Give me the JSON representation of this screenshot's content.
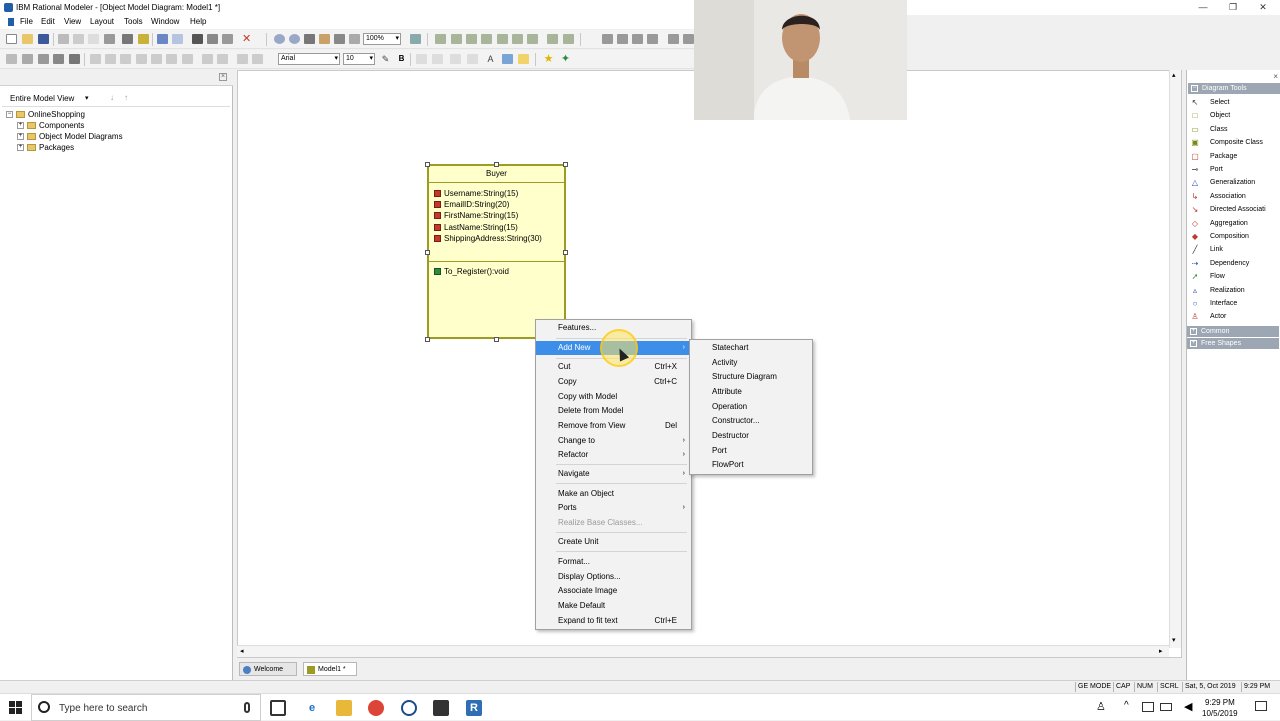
{
  "window": {
    "title": "IBM Rational Modeler - [Object Model Diagram: Model1 *]",
    "minimize": "—",
    "restore": "❐",
    "close": "✕"
  },
  "menubar": [
    "File",
    "Edit",
    "View",
    "Layout",
    "Tools",
    "Window",
    "Help"
  ],
  "toolbar": {
    "zoom": "100%",
    "font": "Arial",
    "font_size": "10",
    "bold": "B"
  },
  "model_view": {
    "title": "Entire Model View",
    "tree": [
      {
        "label": "OnlineShopping",
        "level": 0
      },
      {
        "label": "Components",
        "level": 1
      },
      {
        "label": "Object Model Diagrams",
        "level": 1
      },
      {
        "label": "Packages",
        "level": 1
      }
    ]
  },
  "class_box": {
    "name": "Buyer",
    "attributes": [
      "Username:String(15)",
      "EmailID:String(20)",
      "FirstName:String(15)",
      "LastName:String(15)",
      "ShippingAddress:String(30)"
    ],
    "operations": [
      "To_Register():void"
    ]
  },
  "context_menu": {
    "items": [
      {
        "label": "Features...",
        "shortcut": "",
        "submenu": false,
        "disabled": false
      },
      {
        "label": "Add New",
        "shortcut": "",
        "submenu": true,
        "disabled": false,
        "highlighted": true
      },
      {
        "label": "Cut",
        "shortcut": "Ctrl+X",
        "submenu": false,
        "disabled": false
      },
      {
        "label": "Copy",
        "shortcut": "Ctrl+C",
        "submenu": false,
        "disabled": false
      },
      {
        "label": "Copy with Model",
        "shortcut": "",
        "submenu": false,
        "disabled": false
      },
      {
        "label": "Delete from Model",
        "shortcut": "",
        "submenu": false,
        "disabled": false
      },
      {
        "label": "Remove from View",
        "shortcut": "Del",
        "submenu": false,
        "disabled": false
      },
      {
        "label": "Change to",
        "shortcut": "",
        "submenu": true,
        "disabled": false
      },
      {
        "label": "Refactor",
        "shortcut": "",
        "submenu": true,
        "disabled": false
      },
      {
        "label": "Navigate",
        "shortcut": "",
        "submenu": true,
        "disabled": false
      },
      {
        "label": "Make an Object",
        "shortcut": "",
        "submenu": false,
        "disabled": false
      },
      {
        "label": "Ports",
        "shortcut": "",
        "submenu": true,
        "disabled": false
      },
      {
        "label": "Realize Base Classes...",
        "shortcut": "",
        "submenu": false,
        "disabled": true
      },
      {
        "label": "Create Unit",
        "shortcut": "",
        "submenu": false,
        "disabled": false
      },
      {
        "label": "Format...",
        "shortcut": "",
        "submenu": false,
        "disabled": false
      },
      {
        "label": "Display Options...",
        "shortcut": "",
        "submenu": false,
        "disabled": false
      },
      {
        "label": "Associate Image",
        "shortcut": "",
        "submenu": false,
        "disabled": false
      },
      {
        "label": "Make Default",
        "shortcut": "",
        "submenu": false,
        "disabled": false
      },
      {
        "label": "Expand to fit text",
        "shortcut": "Ctrl+E",
        "submenu": false,
        "disabled": false
      }
    ]
  },
  "submenu": {
    "items": [
      "Statechart",
      "Activity",
      "Structure Diagram",
      "Attribute",
      "Operation",
      "Constructor...",
      "Destructor",
      "Port",
      "FlowPort"
    ]
  },
  "diagram_tools": {
    "header": "Diagram Tools",
    "tools": [
      {
        "label": "Select",
        "icon": "arrow-icon",
        "color": "#333333"
      },
      {
        "label": "Object",
        "icon": "object-icon",
        "color": "#7a8a10"
      },
      {
        "label": "Class",
        "icon": "class-icon",
        "color": "#7a8a10"
      },
      {
        "label": "Composite Class",
        "icon": "composite-class-icon",
        "color": "#7a8a10"
      },
      {
        "label": "Package",
        "icon": "package-icon",
        "color": "#c0392b"
      },
      {
        "label": "Port",
        "icon": "port-icon",
        "color": "#333333"
      },
      {
        "label": "Generalization",
        "icon": "generalization-icon",
        "color": "#1f4fa8"
      },
      {
        "label": "Association",
        "icon": "association-icon",
        "color": "#c0392b"
      },
      {
        "label": "Directed Associati",
        "icon": "directed-association-icon",
        "color": "#c0392b"
      },
      {
        "label": "Aggregation",
        "icon": "aggregation-icon",
        "color": "#c0392b"
      },
      {
        "label": "Composition",
        "icon": "composition-icon",
        "color": "#c0392b"
      },
      {
        "label": "Link",
        "icon": "link-icon",
        "color": "#333333"
      },
      {
        "label": "Dependency",
        "icon": "dependency-icon",
        "color": "#1f4fa8"
      },
      {
        "label": "Flow",
        "icon": "flow-icon",
        "color": "#2e8b3e"
      },
      {
        "label": "Realization",
        "icon": "realization-icon",
        "color": "#1f4fa8"
      },
      {
        "label": "Interface",
        "icon": "interface-icon",
        "color": "#1f4fa8"
      },
      {
        "label": "Actor",
        "icon": "actor-icon",
        "color": "#c0392b"
      }
    ],
    "sections": [
      "Common",
      "Free Shapes"
    ]
  },
  "doc_tabs": [
    "Welcome to...",
    "Model1 *"
  ],
  "statusbar": [
    "GE MODE",
    "CAP",
    "NUM",
    "SCRL",
    "Sat, 5, Oct 2019",
    "9:29 PM"
  ],
  "taskbar": {
    "search_placeholder": "Type here to search",
    "time": "9:29 PM",
    "date": "10/5/2019"
  }
}
